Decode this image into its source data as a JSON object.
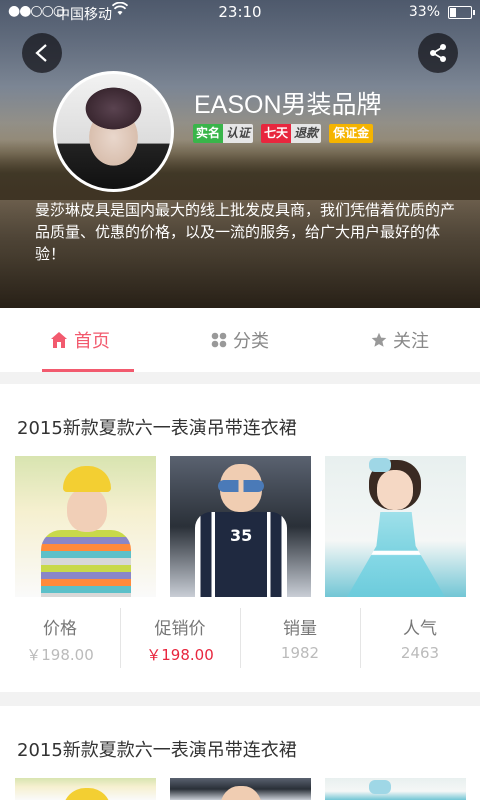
{
  "status_bar": {
    "signal": "●●○○○",
    "carrier": "中国移动",
    "time": "23:10",
    "battery": "33%"
  },
  "header": {
    "back_icon": "back-chevron-icon",
    "share_icon": "share-icon",
    "shop_name": "EASON男装品牌",
    "badges": {
      "real_a": "实名",
      "real_b": "认证",
      "seven_a": "七天",
      "seven_b": "退款",
      "deposit": "保证金"
    },
    "intro": "曼莎琳皮具是国内最大的线上批发皮具商，我们凭借着优质的产品质量、优惠的价格，以及一流的服务，给广大用户最好的体验！"
  },
  "tabs": [
    {
      "label": "首页",
      "icon": "home-icon",
      "active": true
    },
    {
      "label": "分类",
      "icon": "grid-icon",
      "active": false
    },
    {
      "label": "关注",
      "icon": "star-icon",
      "active": false
    }
  ],
  "products": [
    {
      "title": "2015新款夏款六一表演吊带连衣裙",
      "stats": {
        "price_label": "价格",
        "price": "￥198.00",
        "sale_label": "促销价",
        "sale": "￥198.00",
        "sales_label": "销量",
        "sales": "1982",
        "popularity_label": "人气",
        "popularity": "2463"
      }
    },
    {
      "title": "2015新款夏款六一表演吊带连衣裙"
    }
  ],
  "colors": {
    "accent": "#f25a6e",
    "sale_price": "#e8263e",
    "badge_green": "#39b54a",
    "badge_red": "#e8263e",
    "badge_yellow": "#f5b400"
  }
}
